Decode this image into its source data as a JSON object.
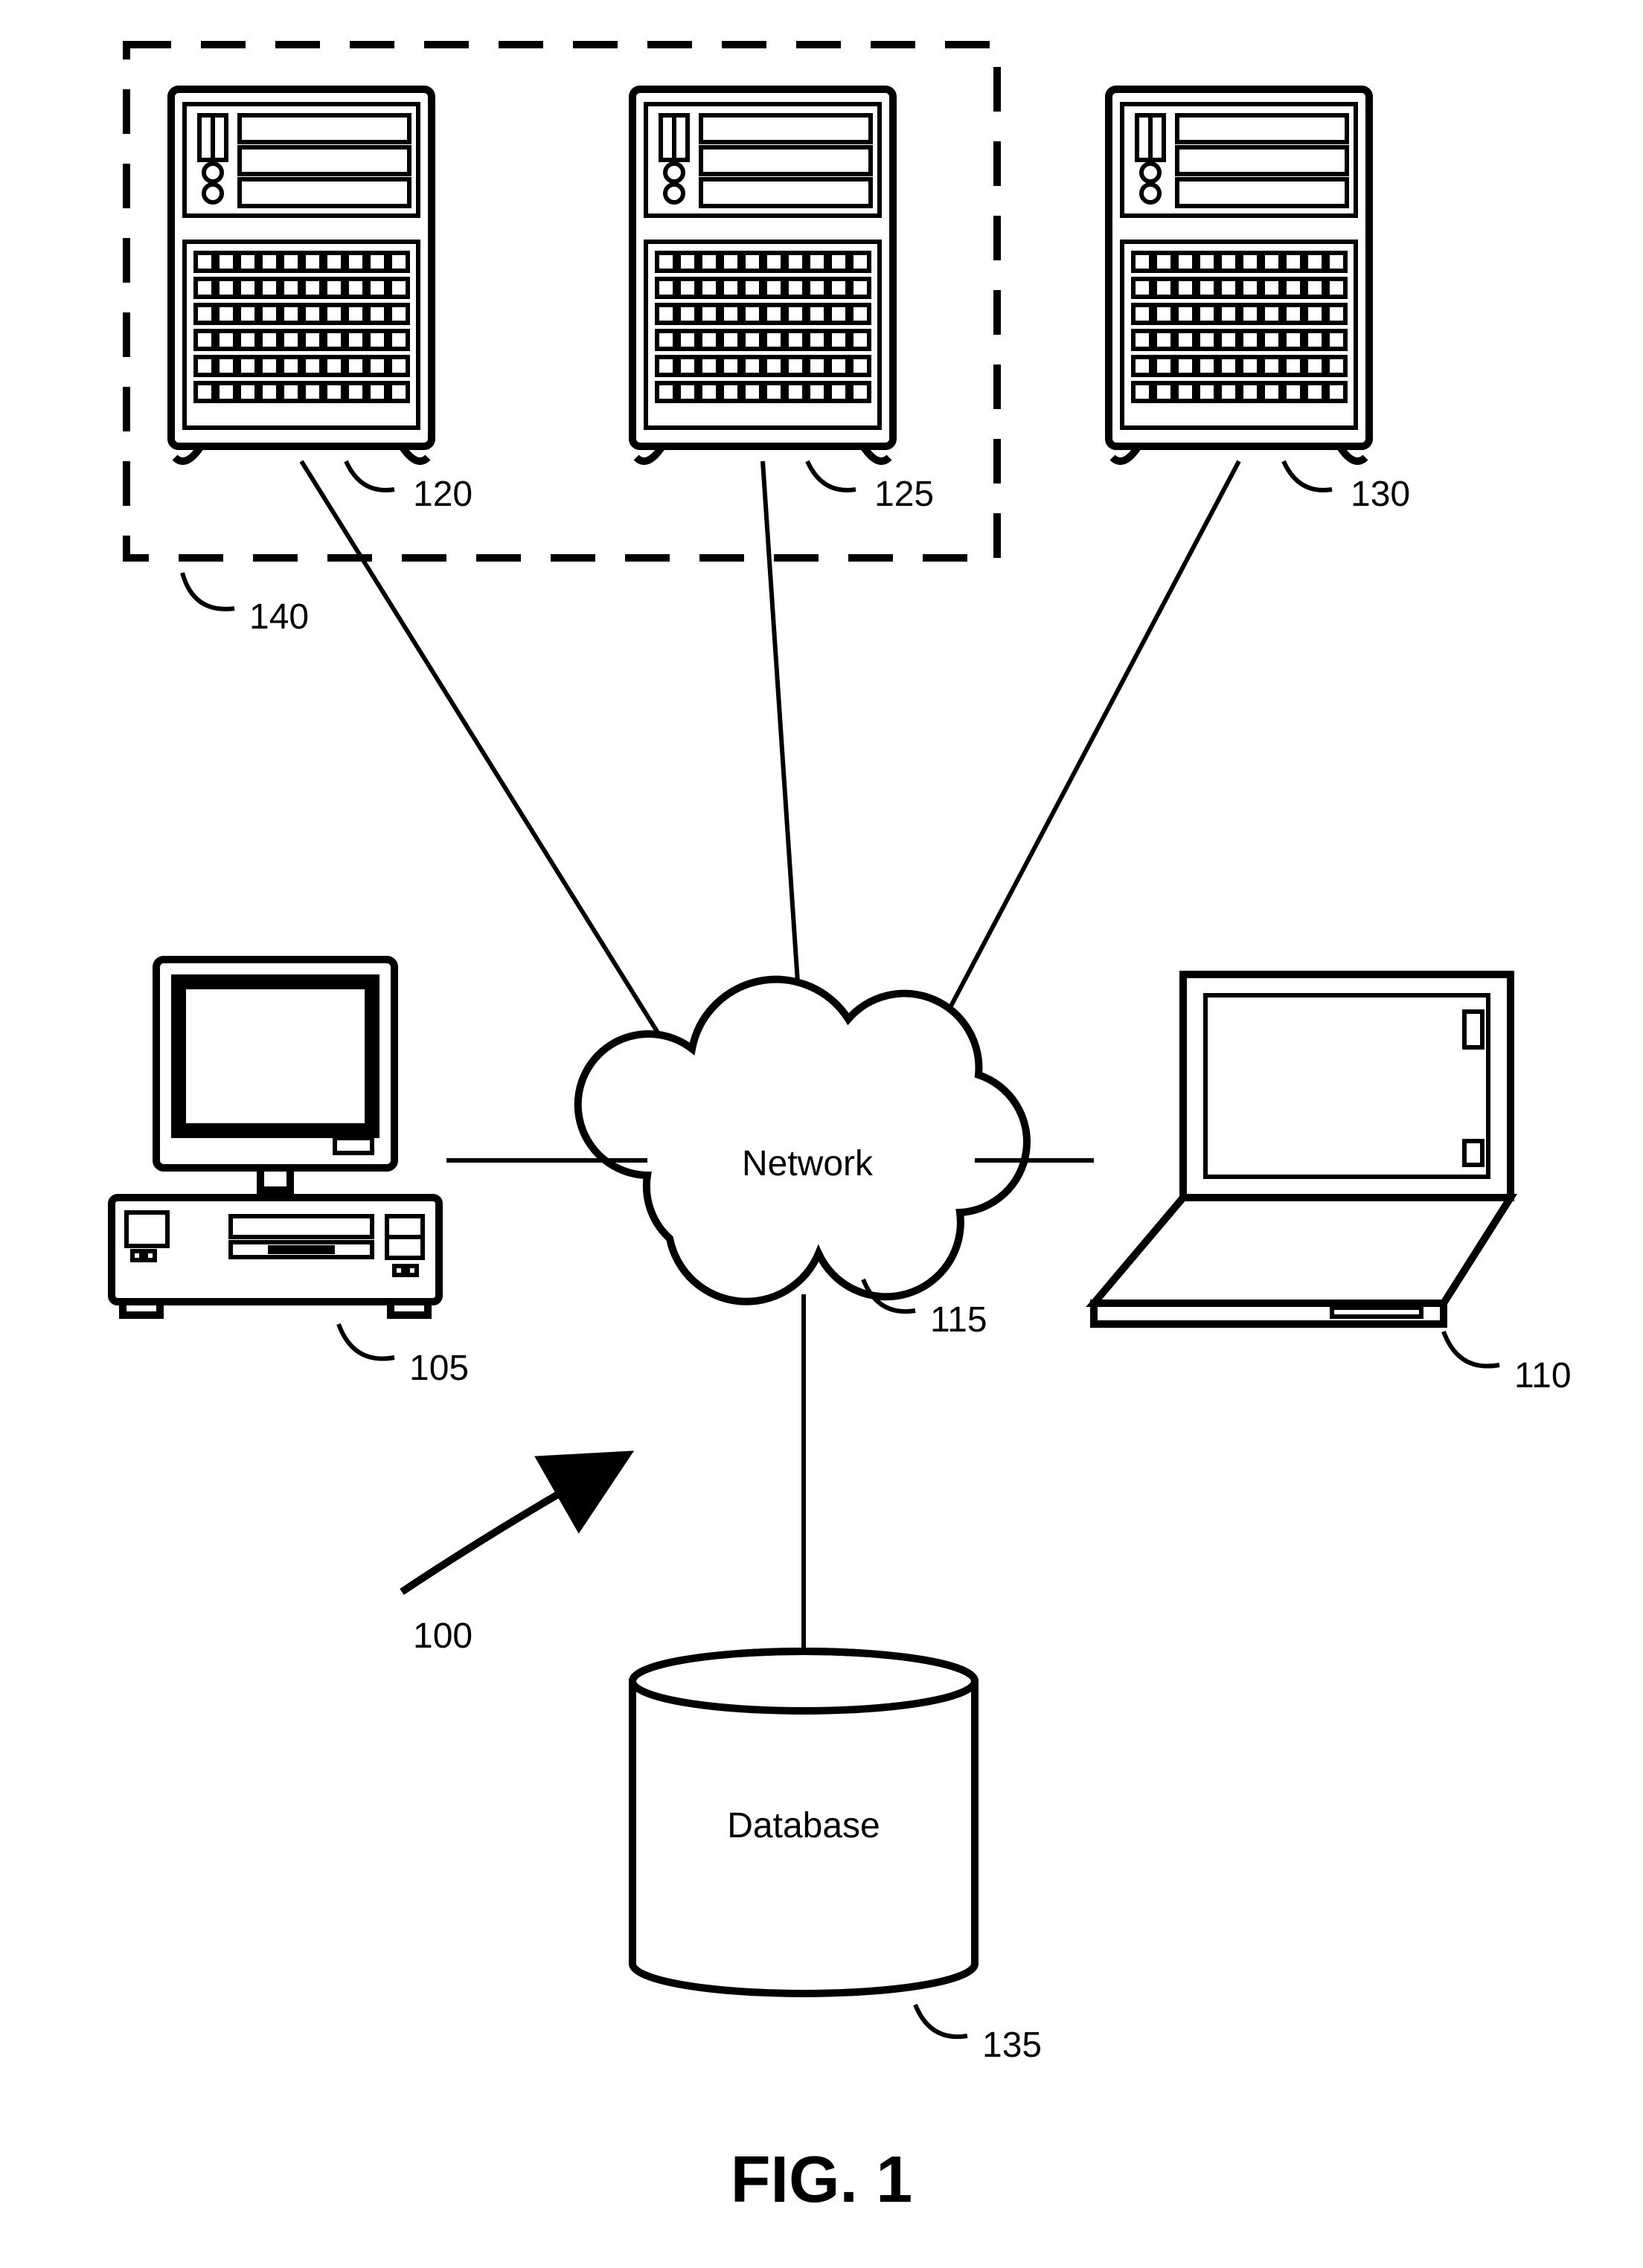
{
  "figure_caption": "FIG. 1",
  "network_label": "Network",
  "database_label": "Database",
  "refs": {
    "system": "100",
    "desktop": "105",
    "laptop": "110",
    "network": "115",
    "serverA": "120",
    "serverB": "125",
    "serverC": "130",
    "database": "135",
    "cluster": "140"
  },
  "nodes": [
    {
      "id": "serverA",
      "kind": "server",
      "label_ref": "120",
      "group": "cluster"
    },
    {
      "id": "serverB",
      "kind": "server",
      "label_ref": "125",
      "group": "cluster"
    },
    {
      "id": "serverC",
      "kind": "server",
      "label_ref": "130"
    },
    {
      "id": "desktop",
      "kind": "desktop",
      "label_ref": "105"
    },
    {
      "id": "laptop",
      "kind": "laptop",
      "label_ref": "110"
    },
    {
      "id": "network",
      "kind": "cloud",
      "label_ref": "115",
      "text": "Network"
    },
    {
      "id": "database",
      "kind": "cylinder",
      "label_ref": "135",
      "text": "Database"
    },
    {
      "id": "cluster",
      "kind": "group",
      "label_ref": "140",
      "contains": [
        "serverA",
        "serverB"
      ]
    }
  ],
  "edges": [
    {
      "from": "serverA",
      "to": "network"
    },
    {
      "from": "serverB",
      "to": "network"
    },
    {
      "from": "serverC",
      "to": "network"
    },
    {
      "from": "desktop",
      "to": "network"
    },
    {
      "from": "laptop",
      "to": "network"
    },
    {
      "from": "database",
      "to": "network"
    }
  ],
  "system_ref": {
    "id": "system",
    "label_ref": "100",
    "arrow_to": "network"
  }
}
